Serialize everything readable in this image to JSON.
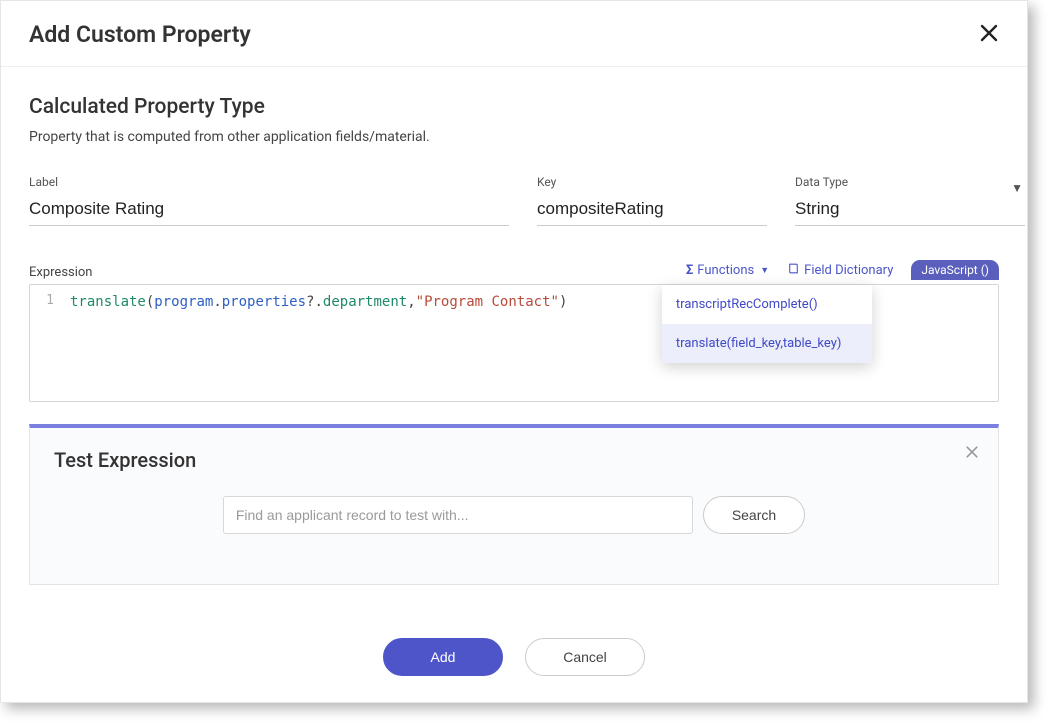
{
  "header": {
    "title": "Add Custom Property"
  },
  "section": {
    "title": "Calculated Property Type",
    "description": "Property that is computed from other application fields/material."
  },
  "fields": {
    "label_label": "Label",
    "label_value": "Composite Rating",
    "key_label": "Key",
    "key_value": "compositeRating",
    "datatype_label": "Data Type",
    "datatype_value": "String"
  },
  "expression": {
    "label": "Expression",
    "tools": {
      "functions": "Functions",
      "field_dictionary": "Field Dictionary",
      "javascript": "JavaScript ()"
    },
    "dropdown": {
      "item1": "transcriptRecComplete()",
      "item2": "translate(field_key,table_key)"
    },
    "code": {
      "line_number": "1",
      "fn": "translate",
      "open": "(",
      "obj1": "program",
      "dot1": ".",
      "prop1": "properties",
      "opt": "?.",
      "dept": "department",
      "comma": ",",
      "str": "\"Program Contact\"",
      "close": ")"
    }
  },
  "test": {
    "title": "Test Expression",
    "placeholder": "Find an applicant record to test with...",
    "search": "Search"
  },
  "footer": {
    "add": "Add",
    "cancel": "Cancel"
  }
}
